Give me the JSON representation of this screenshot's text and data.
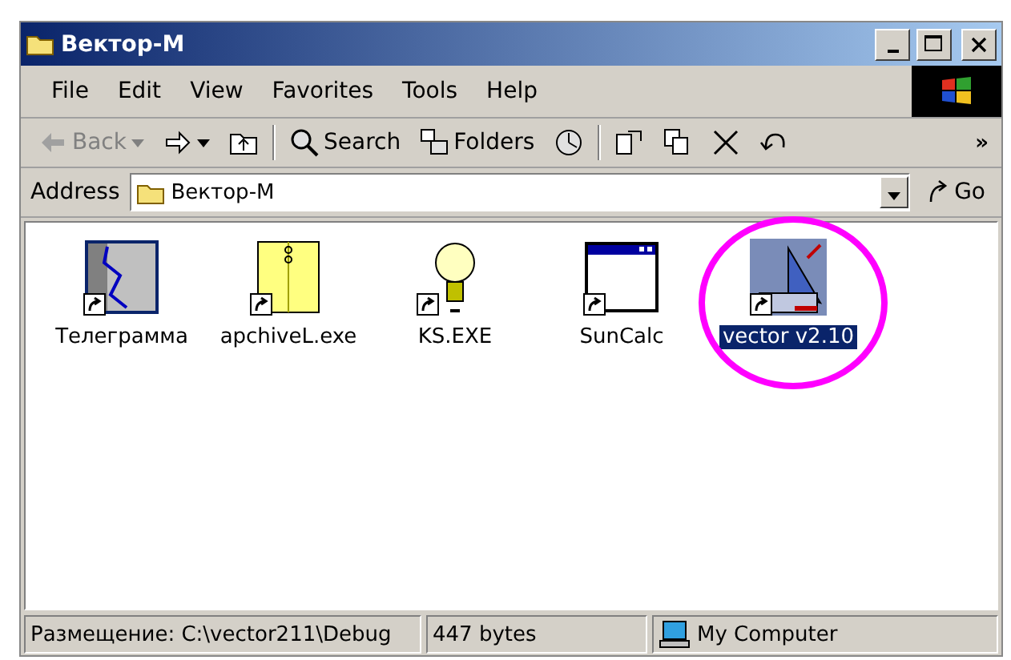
{
  "window": {
    "title": "Вектор-М"
  },
  "menu": [
    "File",
    "Edit",
    "View",
    "Favorites",
    "Tools",
    "Help"
  ],
  "toolbar": [
    {
      "kind": "back",
      "label": "Back",
      "disabled": true
    },
    {
      "kind": "forward"
    },
    {
      "kind": "up"
    },
    {
      "kind": "search",
      "label": "Search"
    },
    {
      "kind": "folders",
      "label": "Folders"
    },
    {
      "kind": "history"
    },
    {
      "kind": "move"
    },
    {
      "kind": "copy"
    },
    {
      "kind": "delete"
    },
    {
      "kind": "undo"
    }
  ],
  "toolbar_more": "»",
  "address": {
    "label": "Address",
    "value": "Вектор-М",
    "go": "Go"
  },
  "files": [
    {
      "name": "Телеграмма",
      "kind": "map",
      "selected": false
    },
    {
      "name": "apchiveL.exe",
      "kind": "envelope",
      "selected": false
    },
    {
      "name": "KS.EXE",
      "kind": "bulb",
      "selected": false
    },
    {
      "name": "SunCalc",
      "kind": "window",
      "selected": false
    },
    {
      "name": "vector v2.10",
      "kind": "dish",
      "selected": true,
      "circled": true
    }
  ],
  "status_bar": {
    "location": "Размещение: C:\\vector211\\Debug",
    "size": "447 bytes",
    "zone": "My Computer"
  }
}
